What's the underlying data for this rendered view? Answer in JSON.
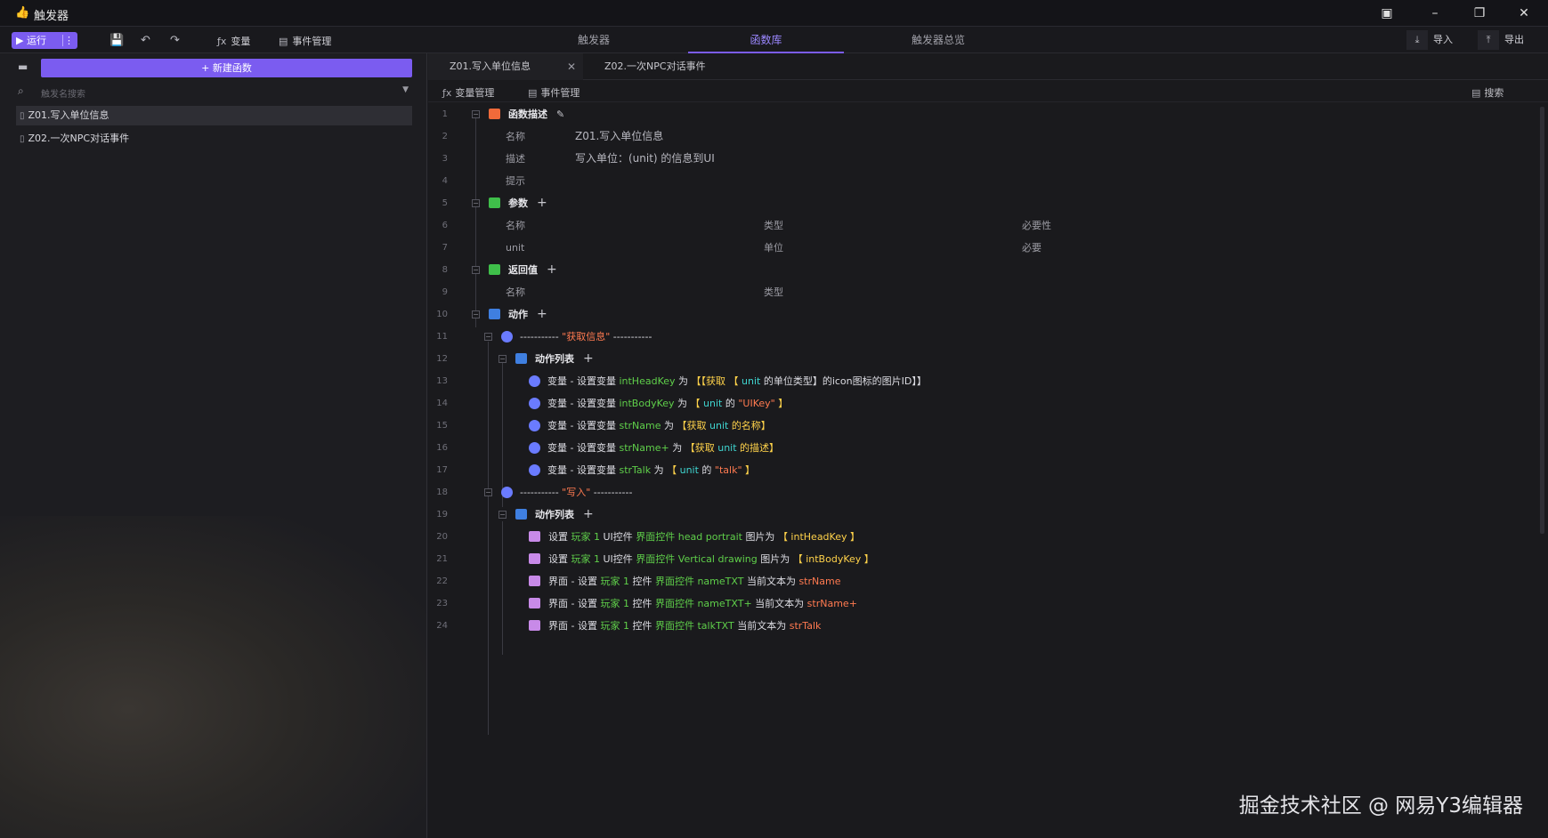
{
  "window": {
    "title": "触发器",
    "icons": [
      "thumb-icon",
      "help-icon",
      "minimize-icon",
      "restore-icon",
      "close-icon"
    ]
  },
  "toolbar": {
    "run_label": "▶ 运行",
    "more_label": "⋮",
    "variable_label": "变量",
    "event_label": "事件管理",
    "tabs": [
      {
        "label": "触发器"
      },
      {
        "label": "函数库"
      },
      {
        "label": "触发器总览"
      }
    ],
    "active_tab": "函数库",
    "import_label": "导入",
    "export_label": "导出"
  },
  "sidebar": {
    "new_button": "新建函数",
    "search_placeholder": "触发名搜索",
    "items": [
      {
        "label": "Z01.写入单位信息"
      },
      {
        "label": "Z02.一次NPC对话事件"
      }
    ],
    "selected": "Z01.写入单位信息"
  },
  "editor": {
    "tabs": [
      {
        "label": "Z01.写入单位信息"
      },
      {
        "label": "Z02.一次NPC对话事件"
      }
    ],
    "subbar": {
      "variable_label": "变量管理",
      "event_label": "事件管理",
      "search_label": "搜索"
    },
    "lines": {
      "l1": "函数描述",
      "l2_label": "名称",
      "l2_value": "Z01.写入单位信息",
      "l3_label": "描述",
      "l3_value": "写入单位：(unit) 的信息到UI",
      "l4_label": "提示",
      "l5": "参数",
      "l6_name": "名称",
      "l6_type": "类型",
      "l6_req": "必要性",
      "l7_name": "unit",
      "l7_type": "单位",
      "l7_req": "必要",
      "l8": "返回值",
      "l9_name": "名称",
      "l9_type": "类型",
      "l10": "动作",
      "l11_dash1": "-----------",
      "l11_str": "\"获取信息\"",
      "l11_dash2": "-----------",
      "l12": "动作列表",
      "l13": {
        "a": "变量 - 设置变量",
        "b": "intHeadKey",
        "c": "为",
        "d": "【【获取",
        "e": "【",
        "f": "unit",
        "g": "的单位类型】",
        "h": "的icon图标的图片ID】】"
      },
      "l14": {
        "a": "变量 - 设置变量",
        "b": "intBodyKey",
        "c": "为",
        "d": "【",
        "f": "unit",
        "g": "的",
        "h": "\"UIKey\"",
        "i": "】"
      },
      "l15": {
        "a": "变量 - 设置变量",
        "b": "strName",
        "c": "为",
        "d": "【获取",
        "f": "unit",
        "g": "的名称】"
      },
      "l16": {
        "a": "变量 - 设置变量",
        "b": "strName+",
        "c": "为",
        "d": "【获取",
        "f": "unit",
        "g": "的描述】"
      },
      "l17": {
        "a": "变量 - 设置变量",
        "b": "strTalk",
        "c": "为",
        "d": "【",
        "f": "unit",
        "g": "的",
        "h": "\"talk\"",
        "i": "】"
      },
      "l18_dash1": "-----------",
      "l18_str": "\"写入\"",
      "l18_dash2": "-----------",
      "l19": "动作列表",
      "l20": {
        "a": "设置",
        "b": "玩家 1",
        "c": "UI控件",
        "d": "界面控件 head portrait",
        "e": "图片为",
        "f": "【 intHeadKey 】"
      },
      "l21": {
        "a": "设置",
        "b": "玩家 1",
        "c": "UI控件",
        "d": "界面控件 Vertical drawing",
        "e": "图片为",
        "f": "【 intBodyKey 】"
      },
      "l22": {
        "a": "界面 - 设置",
        "b": "玩家 1",
        "c": "控件",
        "d": "界面控件 nameTXT",
        "e": "当前文本为",
        "f": "strName"
      },
      "l23": {
        "a": "界面 - 设置",
        "b": "玩家 1",
        "c": "控件",
        "d": "界面控件 nameTXT+",
        "e": "当前文本为",
        "f": "strName+"
      },
      "l24": {
        "a": "界面 - 设置",
        "b": "玩家 1",
        "c": "控件",
        "d": "界面控件 talkTXT",
        "e": "当前文本为",
        "f": "strTalk"
      }
    },
    "line_numbers": [
      "1",
      "2",
      "3",
      "4",
      "5",
      "6",
      "7",
      "8",
      "9",
      "10",
      "11",
      "12",
      "13",
      "14",
      "15",
      "16",
      "17",
      "18",
      "19",
      "20",
      "21",
      "22",
      "23",
      "24"
    ]
  },
  "watermark": "掘金技术社区 @ 网易Y3编辑器",
  "colors": {
    "accent": "#7b5cf0",
    "variable": "#5fcf4a",
    "unit": "#3fd5d0",
    "string": "#ff7a50",
    "bracket": "#ffd24a"
  }
}
